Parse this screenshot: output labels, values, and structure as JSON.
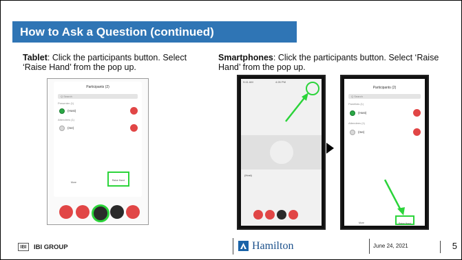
{
  "slide": {
    "title": "How to Ask a Question (continued)"
  },
  "tablet": {
    "label_bold": "Tablet",
    "label_text": ": Click the participants button. Select ‘Raise Hand’ from the pop up.",
    "screen_title": "Participants (2)",
    "search_placeholder": "Q Search",
    "section_speaking": "Presenter (1)",
    "section_other": "Attendees (1)",
    "person1": "(Host)",
    "person2": "(me)",
    "btn_more": "More",
    "btn_raise": "Raise Hand"
  },
  "phone": {
    "label_bold": "Smartphones",
    "label_text": ": Click the participants button. Select ‘Raise Hand’ from the pop up.",
    "status_left": "9:41 AM",
    "status_mid": "4:26 PM",
    "panelist_label": "(Host)",
    "participants_title": "Participants (2)",
    "search_placeholder": "Q Search",
    "section_one": "Panelists (1)",
    "section_two": "Attendees (1)",
    "person1": "(Host)",
    "person2": "(me)",
    "btn_more": "More",
    "btn_raise": "Raise Hand"
  },
  "footer": {
    "logo_mark": "IBI",
    "org_name": "IBI GROUP",
    "city_name": "Hamilton",
    "date": "June 24, 2021",
    "page": "5"
  },
  "colors": {
    "title_bar": "#2f75b5",
    "highlight_green": "#2bd43a",
    "control_red": "#e14646"
  }
}
